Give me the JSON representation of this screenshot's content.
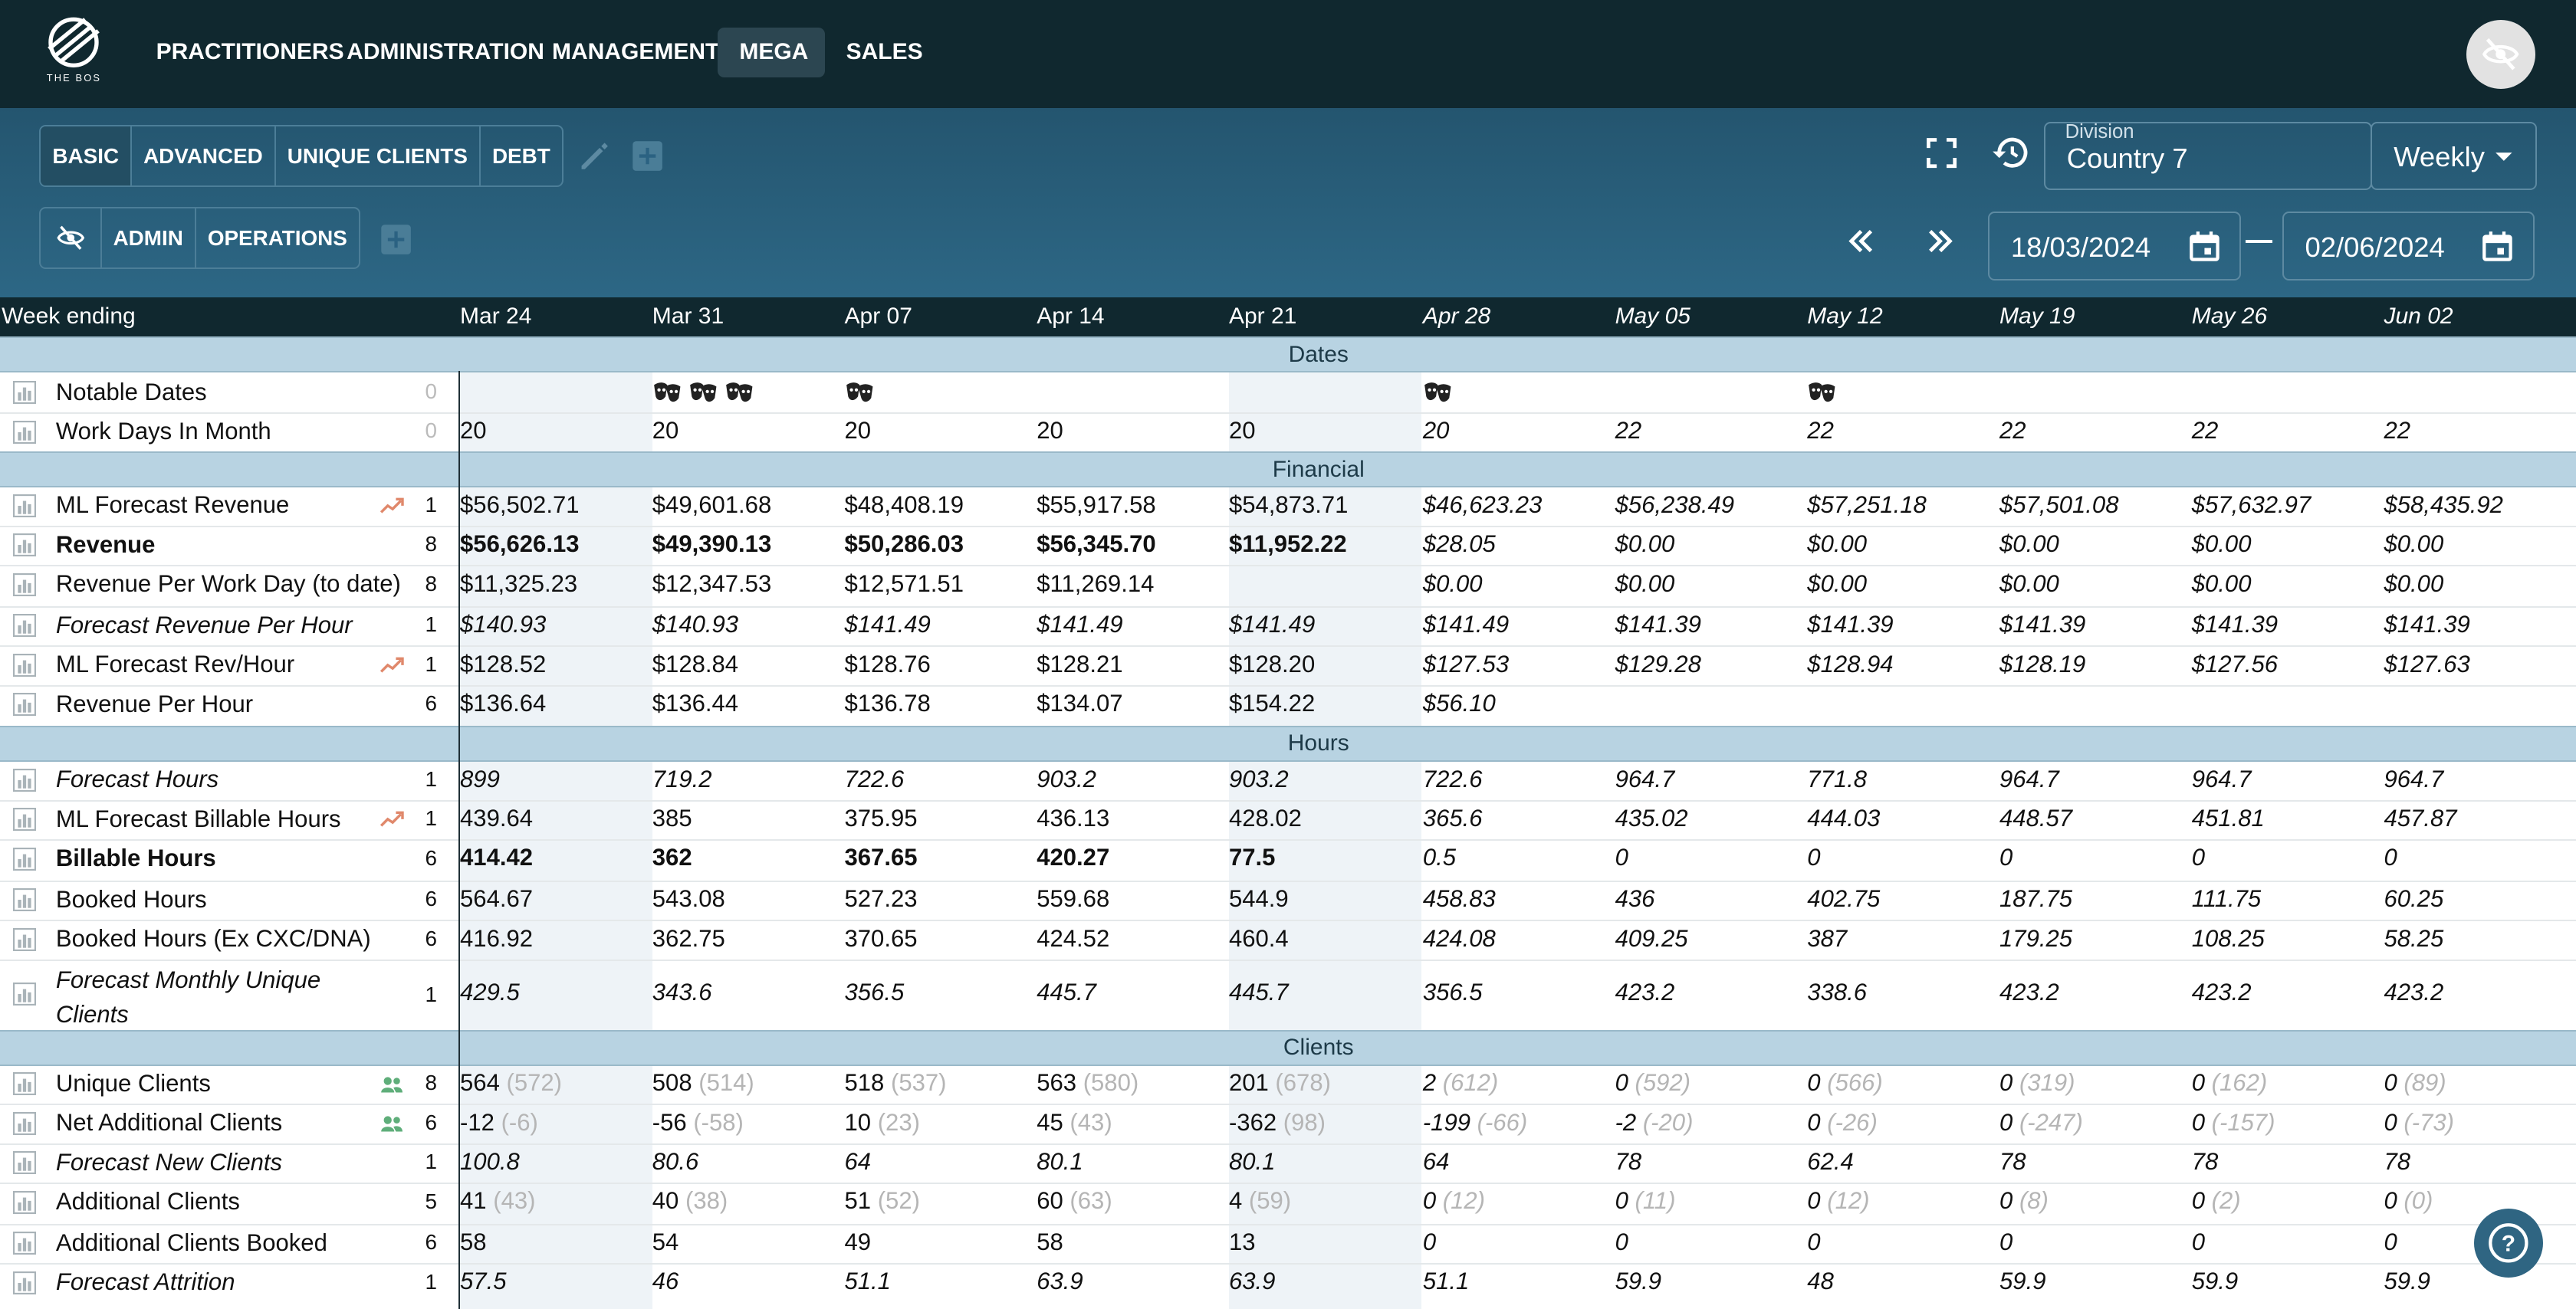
{
  "brand": {
    "logo_text": "THE BOS"
  },
  "nav": {
    "items": [
      "PRACTITIONERS",
      "ADMINISTRATION",
      "MANAGEMENT",
      "MEGA",
      "SALES"
    ],
    "active": "MEGA"
  },
  "view_tabs": [
    "BASIC",
    "ADVANCED",
    "UNIQUE CLIENTS",
    "DEBT"
  ],
  "filter_tabs": [
    "ADMIN",
    "OPERATIONS"
  ],
  "division": {
    "label": "Division",
    "value": "Country 7"
  },
  "period": {
    "value": "Weekly"
  },
  "date_range": {
    "start": "18/03/2024",
    "separator": "—",
    "end": "02/06/2024"
  },
  "table": {
    "header_label": "Week ending",
    "weeks": [
      "Mar 24",
      "Mar 31",
      "Apr 07",
      "Apr 14",
      "Apr 21",
      "Apr 28",
      "May 05",
      "May 12",
      "May 19",
      "May 26",
      "Jun 02"
    ],
    "sections": [
      {
        "title": "Dates",
        "rows": [
          {
            "label": "Notable Dates",
            "count": "0",
            "icons": [
              0,
              3,
              1,
              0,
              0,
              1,
              0,
              1,
              0,
              0,
              0
            ]
          },
          {
            "label": "Work Days In Month",
            "count": "0",
            "values": [
              "20",
              "20",
              "20",
              "20",
              "20",
              "20",
              "22",
              "22",
              "22",
              "22",
              "22"
            ]
          }
        ]
      },
      {
        "title": "Financial",
        "rows": [
          {
            "label": "ML Forecast Revenue",
            "count": "1",
            "icon": "trend-icon",
            "values": [
              "$56,502.71",
              "$49,601.68",
              "$48,408.19",
              "$55,917.58",
              "$54,873.71",
              "$46,623.23",
              "$56,238.49",
              "$57,251.18",
              "$57,501.08",
              "$57,632.97",
              "$58,435.92"
            ]
          },
          {
            "label": "Revenue",
            "count": "8",
            "bold": true,
            "values": [
              "$56,626.13",
              "$49,390.13",
              "$50,286.03",
              "$56,345.70",
              "$11,952.22",
              "$28.05",
              "$0.00",
              "$0.00",
              "$0.00",
              "$0.00",
              "$0.00"
            ]
          },
          {
            "label": "Revenue Per Work Day (to date)",
            "count": "8",
            "values": [
              "$11,325.23",
              "$12,347.53",
              "$12,571.51",
              "$11,269.14",
              "",
              "$0.00",
              "$0.00",
              "$0.00",
              "$0.00",
              "$0.00",
              "$0.00"
            ]
          },
          {
            "label": "Forecast Revenue Per Hour",
            "count": "1",
            "italic": true,
            "values": [
              "$140.93",
              "$140.93",
              "$141.49",
              "$141.49",
              "$141.49",
              "$141.49",
              "$141.39",
              "$141.39",
              "$141.39",
              "$141.39",
              "$141.39"
            ]
          },
          {
            "label": "ML Forecast Rev/Hour",
            "count": "1",
            "icon": "trend-icon",
            "values": [
              "$128.52",
              "$128.84",
              "$128.76",
              "$128.21",
              "$128.20",
              "$127.53",
              "$129.28",
              "$128.94",
              "$128.19",
              "$127.56",
              "$127.63"
            ]
          },
          {
            "label": "Revenue Per Hour",
            "count": "6",
            "values": [
              "$136.64",
              "$136.44",
              "$136.78",
              "$134.07",
              "$154.22",
              "$56.10",
              "",
              "",
              "",
              "",
              ""
            ]
          }
        ]
      },
      {
        "title": "Hours",
        "rows": [
          {
            "label": "Forecast Hours",
            "count": "1",
            "italic": true,
            "values": [
              "899",
              "719.2",
              "722.6",
              "903.2",
              "903.2",
              "722.6",
              "964.7",
              "771.8",
              "964.7",
              "964.7",
              "964.7"
            ]
          },
          {
            "label": "ML Forecast Billable Hours",
            "count": "1",
            "icon": "trend-icon",
            "values": [
              "439.64",
              "385",
              "375.95",
              "436.13",
              "428.02",
              "365.6",
              "435.02",
              "444.03",
              "448.57",
              "451.81",
              "457.87"
            ]
          },
          {
            "label": "Billable Hours",
            "count": "6",
            "bold": true,
            "values": [
              "414.42",
              "362",
              "367.65",
              "420.27",
              "77.5",
              "0.5",
              "0",
              "0",
              "0",
              "0",
              "0"
            ]
          },
          {
            "label": "Booked Hours",
            "count": "6",
            "values": [
              "564.67",
              "543.08",
              "527.23",
              "559.68",
              "544.9",
              "458.83",
              "436",
              "402.75",
              "187.75",
              "111.75",
              "60.25"
            ]
          },
          {
            "label": "Booked Hours (Ex CXC/DNA)",
            "count": "6",
            "values": [
              "416.92",
              "362.75",
              "370.65",
              "424.52",
              "460.4",
              "424.08",
              "409.25",
              "387",
              "179.25",
              "108.25",
              "58.25"
            ]
          },
          {
            "label": "Forecast Monthly Unique",
            "label2": "Clients",
            "count": "1",
            "italic": true,
            "tall": true,
            "values": [
              "429.5",
              "343.6",
              "356.5",
              "445.7",
              "445.7",
              "356.5",
              "423.2",
              "338.6",
              "423.2",
              "423.2",
              "423.2"
            ]
          }
        ]
      },
      {
        "title": "Clients",
        "rows": [
          {
            "label": "Unique Clients",
            "count": "8",
            "icon": "people-icon",
            "values": [
              "564",
              "508",
              "518",
              "563",
              "201",
              "2",
              "0",
              "0",
              "0",
              "0",
              "0"
            ],
            "subs": [
              "(572)",
              "(514)",
              "(537)",
              "(580)",
              "(678)",
              "(612)",
              "(592)",
              "(566)",
              "(319)",
              "(162)",
              "(89)"
            ]
          },
          {
            "label": "Net Additional Clients",
            "count": "6",
            "icon": "people-icon",
            "values": [
              "-12",
              "-56",
              "10",
              "45",
              "-362",
              "-199",
              "-2",
              "0",
              "0",
              "0",
              "0"
            ],
            "subs": [
              "(-6)",
              "(-58)",
              "(23)",
              "(43)",
              "(98)",
              "(-66)",
              "(-20)",
              "(-26)",
              "(-247)",
              "(-157)",
              "(-73)"
            ]
          },
          {
            "label": "Forecast New Clients",
            "count": "1",
            "italic": true,
            "values": [
              "100.8",
              "80.6",
              "64",
              "80.1",
              "80.1",
              "64",
              "78",
              "62.4",
              "78",
              "78",
              "78"
            ]
          },
          {
            "label": "Additional Clients",
            "count": "5",
            "values": [
              "41",
              "40",
              "51",
              "60",
              "4",
              "0",
              "0",
              "0",
              "0",
              "0",
              "0"
            ],
            "subs": [
              "(43)",
              "(38)",
              "(52)",
              "(63)",
              "(59)",
              "(12)",
              "(11)",
              "(12)",
              "(8)",
              "(2)",
              "(0)"
            ]
          },
          {
            "label": "Additional Clients Booked",
            "count": "6",
            "values": [
              "58",
              "54",
              "49",
              "58",
              "13",
              "0",
              "0",
              "0",
              "0",
              "0",
              "0"
            ]
          },
          {
            "label": "Forecast Attrition",
            "count": "1",
            "italic": true,
            "values": [
              "57.5",
              "46",
              "51.1",
              "63.9",
              "63.9",
              "51.1",
              "59.9",
              "48",
              "59.9",
              "59.9",
              "59.9"
            ]
          }
        ]
      }
    ]
  },
  "colors": {
    "nav_bg": "#10282f",
    "toolbar_bg": "#2b6282",
    "section_bg": "#b8d3e2",
    "forecast_shade": "#eef3f7"
  }
}
